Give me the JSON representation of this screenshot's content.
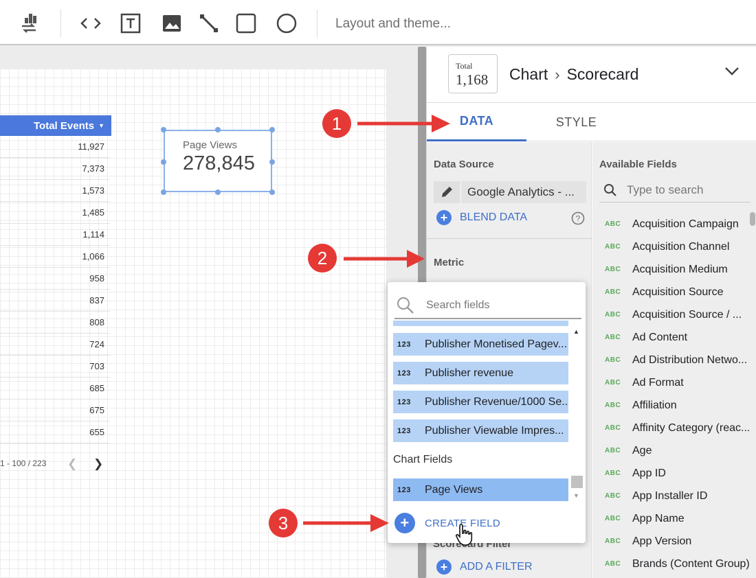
{
  "toolbar": {
    "tools": [
      {
        "name": "chart-swap-icon"
      },
      {
        "name": "embed-code-icon"
      },
      {
        "name": "text-tool-icon"
      },
      {
        "name": "image-tool-icon"
      },
      {
        "name": "line-tool-icon"
      },
      {
        "name": "rectangle-tool-icon"
      },
      {
        "name": "circle-tool-icon"
      }
    ],
    "theme_label": "Layout and theme..."
  },
  "table": {
    "header": "Total Events",
    "rows": [
      "11,927",
      "7,373",
      "1,573",
      "1,485",
      "1,114",
      "1,066",
      "958",
      "837",
      "808",
      "724",
      "703",
      "685",
      "675",
      "655"
    ],
    "pagination": "1 - 100 / 223"
  },
  "scorecard": {
    "label": "Page Views",
    "value": "278,845"
  },
  "panel": {
    "thumb_label": "Total",
    "thumb_value": "1,168",
    "breadcrumb": [
      "Chart",
      "Scorecard"
    ],
    "tabs": {
      "data": "DATA",
      "style": "STYLE"
    },
    "data_source_title": "Data Source",
    "data_source_name": "Google Analytics - ...",
    "blend_label": "BLEND DATA",
    "metric_title": "Metric",
    "filter_title": "Scorecard Filter",
    "add_filter_label": "ADD A FILTER",
    "available_fields_title": "Available Fields",
    "fields_search_placeholder": "Type to search",
    "fields": [
      "Acquisition Campaign",
      "Acquisition Channel",
      "Acquisition Medium",
      "Acquisition Source",
      "Acquisition Source / ...",
      "Ad Content",
      "Ad Distribution Netwo...",
      "Ad Format",
      "Affiliation",
      "Affinity Category (reac...",
      "Age",
      "App ID",
      "App Installer ID",
      "App Name",
      "App Version",
      "Brands (Content Group)"
    ],
    "dimension_badge": "ABC"
  },
  "dropdown": {
    "search_placeholder": "Search fields",
    "metric_badge": "123",
    "items": [
      "Publisher Monetised Pagev...",
      "Publisher revenue",
      "Publisher Revenue/1000 Se...",
      "Publisher Viewable Impres..."
    ],
    "group_title": "Chart Fields",
    "selected_item": "Page Views",
    "create_label": "CREATE FIELD"
  },
  "annotations": [
    "1",
    "2",
    "3"
  ],
  "colors": {
    "accent": "#3e6ec7",
    "table_header": "#4a78dc",
    "annotation_red": "#e53935",
    "dropdown_item": "#b6d3f6",
    "dropdown_selected": "#8ebaf2",
    "dimension_green": "#5aa85a"
  }
}
